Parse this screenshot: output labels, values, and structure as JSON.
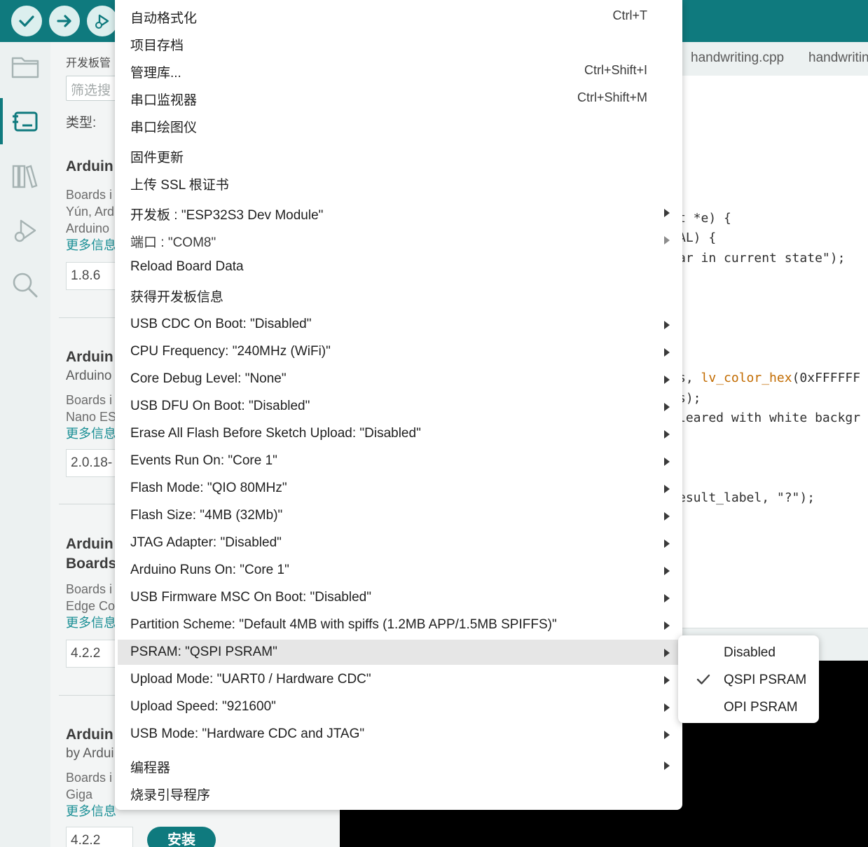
{
  "toolbar": {
    "buttons": [
      {
        "name": "verify-button",
        "icon": "check-icon"
      },
      {
        "name": "upload-button",
        "icon": "arrow-right-icon"
      },
      {
        "name": "debug-button",
        "icon": "debug-icon"
      }
    ]
  },
  "activity_bar": {
    "items": [
      {
        "icon": "folder-icon"
      },
      {
        "icon": "board-icon",
        "active": true
      },
      {
        "icon": "library-icon"
      },
      {
        "icon": "debug-icon"
      },
      {
        "icon": "search-icon"
      }
    ]
  },
  "panel": {
    "title": "开发板管",
    "filter_placeholder": "筛选搜",
    "type_label": "类型:",
    "entries": [
      {
        "title": "Arduin",
        "desc1": "Boards i",
        "desc2": "Yún, Ard",
        "desc3": "Arduino",
        "more": "更多信息",
        "version": "1.8.6"
      },
      {
        "title": "Arduin",
        "sub": "Arduino",
        "desc1": "Boards i",
        "desc2": "Nano ES",
        "more": "更多信息",
        "version": "2.0.18-"
      },
      {
        "title": "Arduin",
        "title2": "Boards",
        "desc1": "Boards i",
        "desc2": "Edge Co",
        "more": "更多信息",
        "version": "4.2.2"
      },
      {
        "title": "Arduin",
        "sub": "by Ardui",
        "desc1": "Boards i",
        "desc2": "Giga",
        "more": "更多信息",
        "version": "4.2.2",
        "install": "安装"
      }
    ]
  },
  "editor": {
    "tabs": [
      "handwriting.cpp",
      "handwritin"
    ],
    "code_lines": [
      {
        "text": "t *e) {"
      },
      {
        "text": "AL) {"
      },
      {
        "text": "ar in current state\");"
      },
      {
        "pre": "s, ",
        "fn": "lv_color_hex",
        "post": "(0xFFFFFF"
      },
      {
        "text": "s);"
      },
      {
        "comment": "leared with white backgr"
      },
      {
        "text": "esult_label, \"?\");"
      }
    ]
  },
  "menu": {
    "items": [
      {
        "label": "自动格式化",
        "shortcut": "Ctrl+T"
      },
      {
        "label": "项目存档"
      },
      {
        "label": "管理库...",
        "shortcut": "Ctrl+Shift+I"
      },
      {
        "label": "串口监视器",
        "shortcut": "Ctrl+Shift+M"
      },
      {
        "label": "串口绘图仪"
      },
      {
        "label": "固件更新"
      },
      {
        "label": "上传 SSL 根证书"
      },
      {
        "label": "开发板 : \"ESP32S3 Dev Module\"",
        "submenu": true
      },
      {
        "label": "端口 : \"COM8\"",
        "submenu": true,
        "disabled": true
      },
      {
        "label": "Reload Board Data"
      },
      {
        "label": "获得开发板信息"
      },
      {
        "label": "USB CDC On Boot: \"Disabled\"",
        "submenu": true
      },
      {
        "label": "CPU Frequency: \"240MHz (WiFi)\"",
        "submenu": true
      },
      {
        "label": "Core Debug Level: \"None\"",
        "submenu": true
      },
      {
        "label": "USB DFU On Boot: \"Disabled\"",
        "submenu": true
      },
      {
        "label": "Erase All Flash Before Sketch Upload: \"Disabled\"",
        "submenu": true
      },
      {
        "label": "Events Run On: \"Core 1\"",
        "submenu": true
      },
      {
        "label": "Flash Mode: \"QIO 80MHz\"",
        "submenu": true
      },
      {
        "label": "Flash Size: \"4MB (32Mb)\"",
        "submenu": true
      },
      {
        "label": "JTAG Adapter: \"Disabled\"",
        "submenu": true
      },
      {
        "label": "Arduino Runs On: \"Core 1\"",
        "submenu": true
      },
      {
        "label": "USB Firmware MSC On Boot: \"Disabled\"",
        "submenu": true
      },
      {
        "label": "Partition Scheme: \"Default 4MB with spiffs (1.2MB APP/1.5MB SPIFFS)\"",
        "submenu": true
      },
      {
        "label": "PSRAM: \"QSPI PSRAM\"",
        "submenu": true,
        "highlighted": true
      },
      {
        "label": "Upload Mode: \"UART0 / Hardware CDC\"",
        "submenu": true
      },
      {
        "label": "Upload Speed: \"921600\"",
        "submenu": true
      },
      {
        "label": "USB Mode: \"Hardware CDC and JTAG\"",
        "submenu": true
      },
      {
        "label": "编程器",
        "submenu": true
      },
      {
        "label": "烧录引导程序"
      }
    ]
  },
  "submenu": {
    "items": [
      {
        "label": "Disabled",
        "checked": false
      },
      {
        "label": "QSPI PSRAM",
        "checked": true
      },
      {
        "label": "OPI PSRAM",
        "checked": false
      }
    ]
  },
  "colors": {
    "accent": "#0f7a7e",
    "highlight": "#e6e6e6",
    "link": "#1a8f95",
    "code_function": "#c26b00"
  }
}
